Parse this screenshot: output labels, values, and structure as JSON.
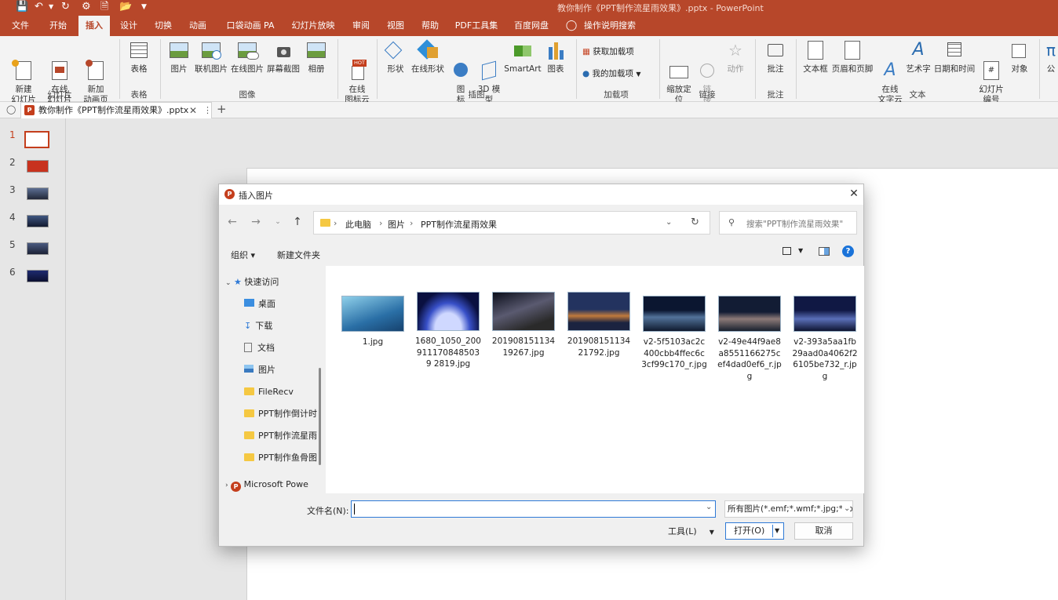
{
  "titlebar": {
    "title": "教你制作《PPT制作流星雨效果》.pptx  -  PowerPoint"
  },
  "tabs": [
    "文件",
    "开始",
    "插入",
    "设计",
    "切换",
    "动画",
    "口袋动画 PA",
    "幻灯片放映",
    "审阅",
    "视图",
    "帮助",
    "PDF工具集",
    "百度网盘",
    "操作说明搜索"
  ],
  "active_tab": "插入",
  "ribbon": {
    "buttons": {
      "new_slide": "新建\n幻灯片",
      "online_slide": "在线\n幻灯片",
      "new_anim_page": "新加\n动画页",
      "table": "表格",
      "picture": "图片",
      "linked_picture": "联机图片",
      "online_picture": "在线图片",
      "screenshot": "屏幕截图",
      "album": "相册",
      "online_icon_cloud": "在线\n图标云",
      "shapes": "形状",
      "online_shapes": "在线形状",
      "icons": "图\n标",
      "model3d": "3D 模\n型",
      "smartart": "SmartArt",
      "chart": "图表",
      "get_addins": "获取加载项",
      "my_addins": "我的加载项",
      "zoom": "缩放定\n位",
      "link": "链\n接",
      "action": "动作",
      "comment": "批注",
      "textbox": "文本框",
      "header_footer": "页眉和页脚",
      "online_text_cloud": "在线\n文字云",
      "wordart": "艺术字",
      "date_time": "日期和时间",
      "slide_number": "幻灯片\n编号",
      "object": "对象",
      "more": "公"
    },
    "groups": [
      "幻灯片",
      "表格",
      "图像",
      "插图",
      "加载项",
      "链接",
      "批注",
      "文本"
    ],
    "hot_badge": "HOT"
  },
  "doc_tab": {
    "name": "教你制作《PPT制作流星雨效果》.pptx"
  },
  "slides": [
    {
      "num": "1",
      "color": "#ffffff"
    },
    {
      "num": "2",
      "color": "#c8321e"
    },
    {
      "num": "3",
      "color": "#3a4b66"
    },
    {
      "num": "4",
      "color": "#1e2a48"
    },
    {
      "num": "5",
      "color": "#2a3450"
    },
    {
      "num": "6",
      "color": "#1a2050"
    }
  ],
  "dialog": {
    "title": "插入图片",
    "breadcrumb": [
      "此电脑",
      "图片",
      "PPT制作流星雨效果"
    ],
    "search_placeholder": "搜索\"PPT制作流星雨效果\"",
    "organize": "组织 ▾",
    "new_folder": "新建文件夹",
    "nav": [
      "快速访问",
      "桌面",
      "下载",
      "文档",
      "图片",
      "FileRecv",
      "PPT制作倒计时",
      "PPT制作流星雨",
      "PPT制作鱼骨图",
      "Microsoft Powe"
    ],
    "files": [
      {
        "name": "1.jpg",
        "c1": "#2a6fa6",
        "c2": "#7ec7e0"
      },
      {
        "name": "1680_1050_2009111708485039 2819.jpg",
        "c1": "#101a5a",
        "c2": "#8aa6ff"
      },
      {
        "name": "20190815113419267.jpg",
        "c1": "#15182a",
        "c2": "#7a6a55"
      },
      {
        "name": "20190815113421792.jpg",
        "c1": "#1d2c58",
        "c2": "#d07a3c"
      },
      {
        "name": "v2-5f5103ac2c400cbb4ffec6c3cf99c170_r.jpg",
        "c1": "#0d1a33",
        "c2": "#52739a"
      },
      {
        "name": "v2-49e44f9ae8a8551166275cef4dad0ef6_r.jpg",
        "c1": "#17233e",
        "c2": "#8c7a78"
      },
      {
        "name": "v2-393a5aa1fb29aad0a4062f26105be732_r.jpg",
        "c1": "#141c4a",
        "c2": "#5a6fb8"
      }
    ],
    "filename_label": "文件名(N):",
    "filename_value": "",
    "filetype": "所有图片(*.emf;*.wmf;*.jpg;*.jp",
    "tools": "工具(L)",
    "open": "打开(O)",
    "cancel": "取消"
  }
}
